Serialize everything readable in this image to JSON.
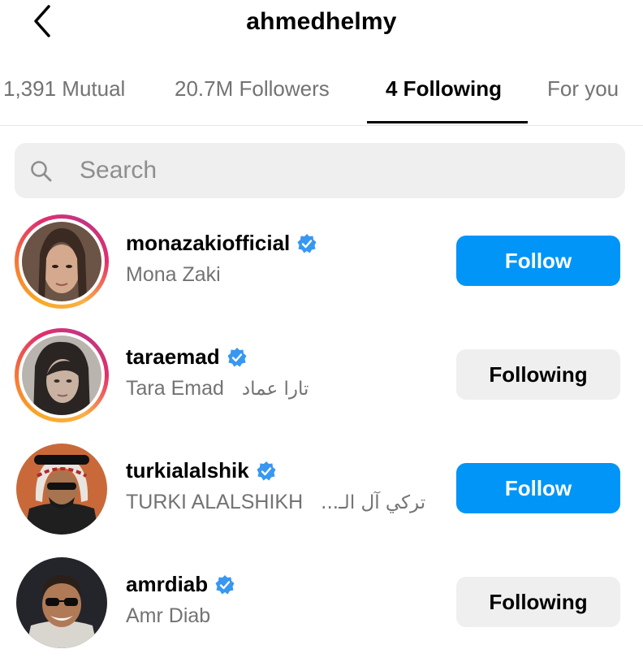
{
  "header": {
    "title": "ahmedhelmy",
    "back_icon": "chevron-left-icon"
  },
  "tabs": [
    {
      "label": "1,391 Mutual",
      "active": false
    },
    {
      "label": "20.7M Followers",
      "active": false
    },
    {
      "label": "4 Following",
      "active": true
    },
    {
      "label": "For you",
      "active": false
    }
  ],
  "search": {
    "placeholder": "Search",
    "value": "",
    "icon": "search-icon"
  },
  "accounts": [
    {
      "username": "monazakiofficial",
      "full_name": "Mona Zaki",
      "full_name_ar": "",
      "verified": true,
      "story_ring": true,
      "button": "Follow"
    },
    {
      "username": "taraemad",
      "full_name": "Tara Emad",
      "full_name_ar": "تارا عماد",
      "verified": true,
      "story_ring": true,
      "button": "Following"
    },
    {
      "username": "turkialalshik",
      "full_name": "TURKI ALALSHIKH",
      "full_name_ar": "تركي آل الـ...",
      "verified": true,
      "story_ring": false,
      "button": "Follow"
    },
    {
      "username": "amrdiab",
      "full_name": "Amr Diab",
      "full_name_ar": "",
      "verified": true,
      "story_ring": false,
      "button": "Following"
    }
  ],
  "colors": {
    "accent": "#0095f6",
    "verified": "#3897f0",
    "secondary_text": "#737373",
    "button_gray": "#efeff0"
  }
}
